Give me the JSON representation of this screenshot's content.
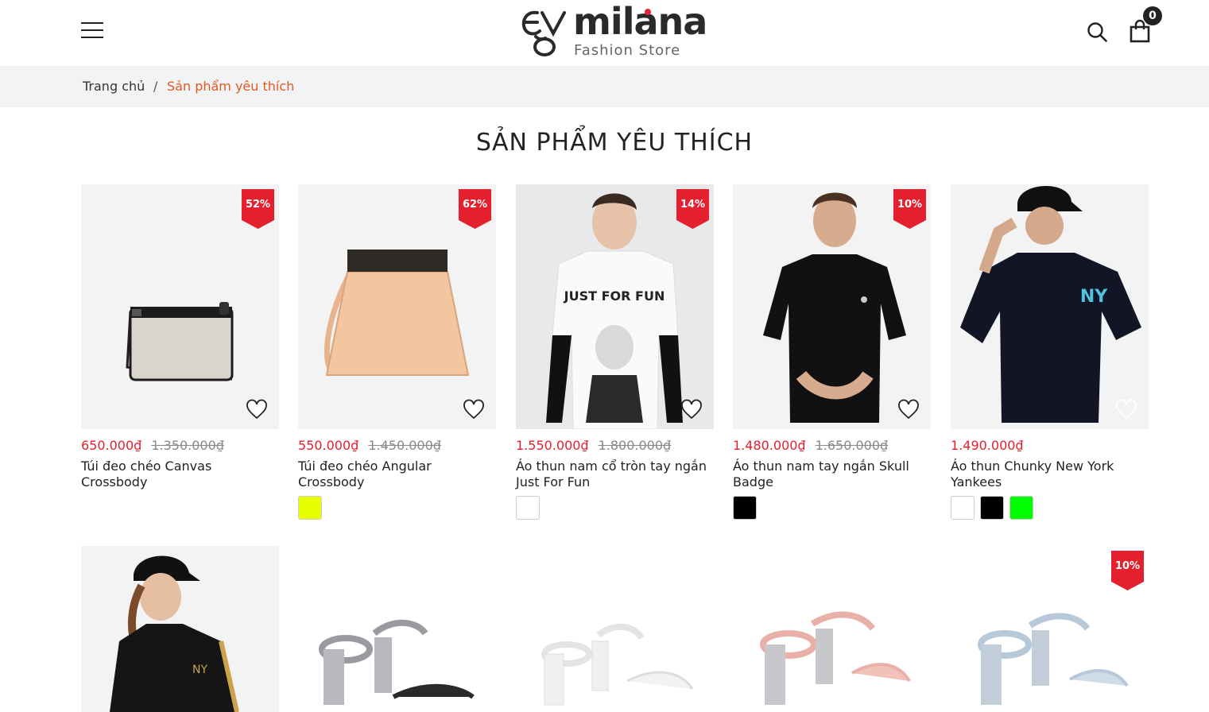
{
  "header": {
    "menu_icon": "hamburger-menu-icon",
    "logo_name": "milana",
    "logo_tagline": "Fashion Store",
    "search_icon": "search-icon",
    "cart_icon": "shopping-bag-icon",
    "cart_count": "0"
  },
  "breadcrumb": {
    "home": "Trang chủ",
    "separator": "/",
    "current": "Sản phẩm yêu thích"
  },
  "page_title": "SẢN PHẨM YÊU THÍCH",
  "colors": {
    "accent": "#e4202f",
    "breadcrumb_current": "#e05a1f"
  },
  "products": [
    {
      "badge": "52%",
      "price": "650.000₫",
      "old_price": "1.350.000₫",
      "name": "Túi đeo chéo Canvas Crossbody",
      "image": "canvas-crossbody-bag",
      "swatches": []
    },
    {
      "badge": "62%",
      "price": "550.000₫",
      "old_price": "1.450.000₫",
      "name": "Túi đeo chéo Angular Crossbody",
      "image": "angular-crossbody-bag",
      "swatches": [
        "#e8ff00"
      ]
    },
    {
      "badge": "14%",
      "price": "1.550.000₫",
      "old_price": "1.800.000₫",
      "name": "Áo thun nam cổ tròn tay ngắn Just For Fun",
      "image": "just-for-fun-tshirt",
      "swatches": [
        "#ffffff"
      ]
    },
    {
      "badge": "10%",
      "price": "1.480.000₫",
      "old_price": "1.650.000₫",
      "name": "Áo thun nam tay ngắn Skull Badge",
      "image": "skull-badge-tshirt",
      "swatches": [
        "#000000"
      ]
    },
    {
      "badge": "",
      "price": "1.490.000₫",
      "old_price": "",
      "name": "Áo thun Chunky New York Yankees",
      "image": "ny-yankees-tshirt",
      "swatches": [
        "#ffffff",
        "#000000",
        "#00ff00"
      ]
    },
    {
      "badge": "",
      "image": "ny-track-jacket"
    },
    {
      "badge": "",
      "image": "silver-block-sandal"
    },
    {
      "badge": "",
      "image": "white-block-sandal"
    },
    {
      "badge": "",
      "image": "pink-block-sandal"
    },
    {
      "badge": "10%",
      "image": "blue-block-sandal"
    }
  ]
}
